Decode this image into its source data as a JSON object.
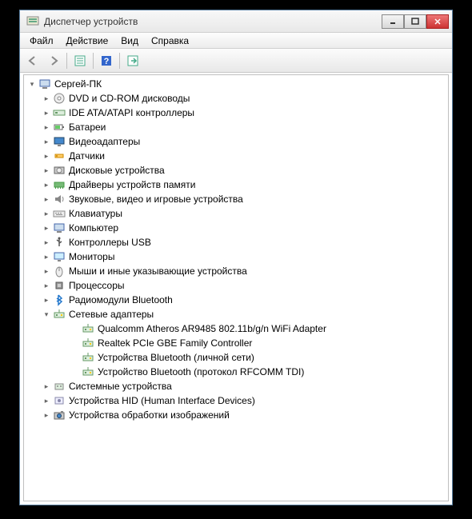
{
  "window": {
    "title": "Диспетчер устройств"
  },
  "menu": {
    "file": "Файл",
    "action": "Действие",
    "view": "Вид",
    "help": "Справка"
  },
  "tree": {
    "root": "Сергей-ПК",
    "categories": [
      "DVD и CD-ROM дисководы",
      "IDE ATA/ATAPI контроллеры",
      "Батареи",
      "Видеоадаптеры",
      "Датчики",
      "Дисковые устройства",
      "Драйверы устройств памяти",
      "Звуковые, видео и игровые устройства",
      "Клавиатуры",
      "Компьютер",
      "Контроллеры USB",
      "Мониторы",
      "Мыши и иные указывающие устройства",
      "Процессоры",
      "Радиомодули Bluetooth",
      "Сетевые адаптеры",
      "Системные устройства",
      "Устройства HID (Human Interface Devices)",
      "Устройства обработки изображений"
    ],
    "network_devices": [
      "Qualcomm Atheros AR9485 802.11b/g/n WiFi Adapter",
      "Realtek PCIe GBE Family Controller",
      "Устройства Bluetooth (личной сети)",
      "Устройство Bluetooth (протокол RFCOMM TDI)"
    ]
  }
}
